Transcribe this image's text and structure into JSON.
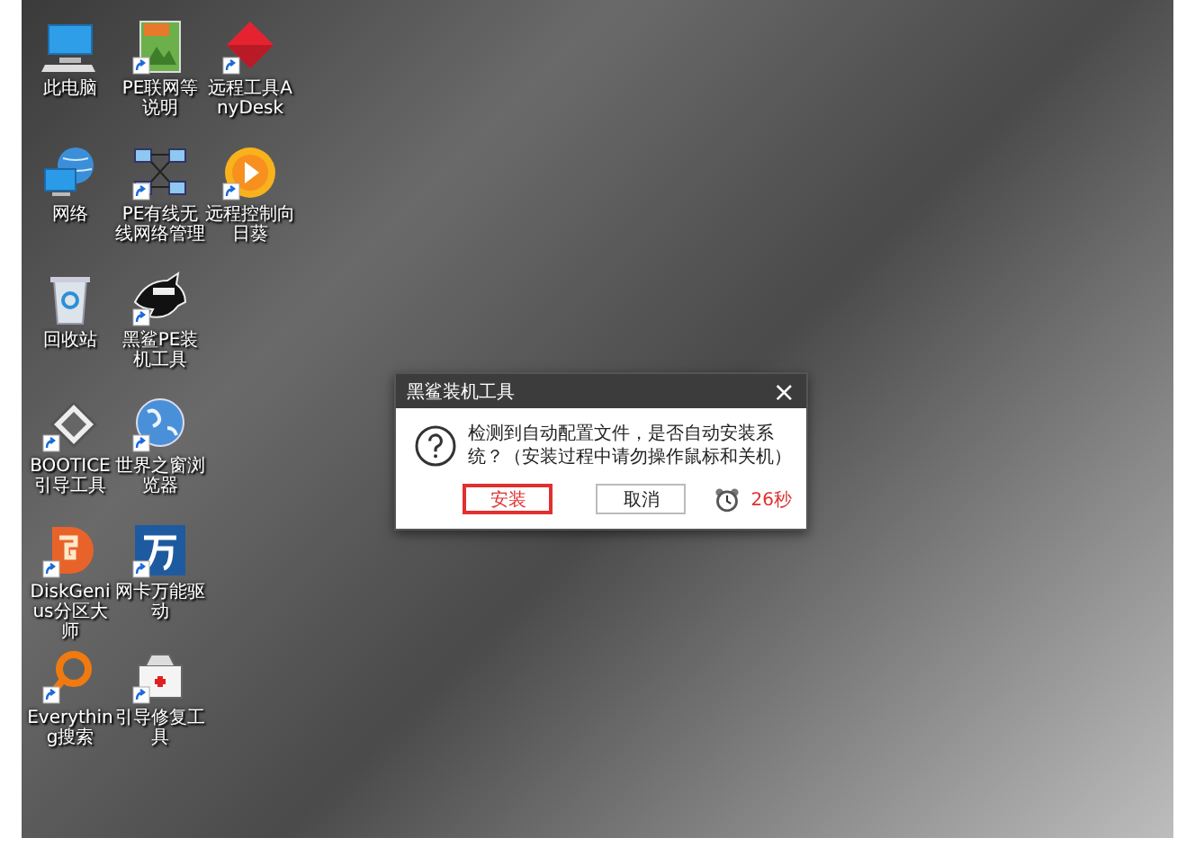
{
  "desktop": {
    "icons": [
      {
        "label": "此电脑",
        "kind": "computer",
        "shortcut": false
      },
      {
        "label": "网络",
        "kind": "network",
        "shortcut": false
      },
      {
        "label": "回收站",
        "kind": "recycle",
        "shortcut": false
      },
      {
        "label": "BOOTICE引导工具",
        "kind": "disk",
        "shortcut": true
      },
      {
        "label": "DiskGenius分区大师",
        "kind": "diskgenius",
        "shortcut": true
      },
      {
        "label": "Everything搜索",
        "kind": "magnifier",
        "shortcut": true
      },
      {
        "label": "PE联网等说明",
        "kind": "pdf",
        "shortcut": true
      },
      {
        "label": "PE有线无线网络管理",
        "kind": "lan",
        "shortcut": true
      },
      {
        "label": "黑鲨PE装机工具",
        "kind": "shark",
        "shortcut": true
      },
      {
        "label": "世界之窗浏览器",
        "kind": "globe",
        "shortcut": true
      },
      {
        "label": "网卡万能驱动",
        "kind": "wan",
        "shortcut": true
      },
      {
        "label": "引导修复工具",
        "kind": "kit",
        "shortcut": true
      },
      {
        "label": "远程工具AnyDesk",
        "kind": "diamond",
        "shortcut": true
      },
      {
        "label": "远程控制向日葵",
        "kind": "sun",
        "shortcut": true
      }
    ]
  },
  "dialog": {
    "title": "黑鲨装机工具",
    "close": "×",
    "message": "检测到自动配置文件，是否自动安装系统？（安装过程中请勿操作鼠标和关机）",
    "buttons": [
      {
        "label": "安装",
        "selected": true
      },
      {
        "label": "取消",
        "selected": false
      }
    ],
    "countdown": "26秒"
  }
}
